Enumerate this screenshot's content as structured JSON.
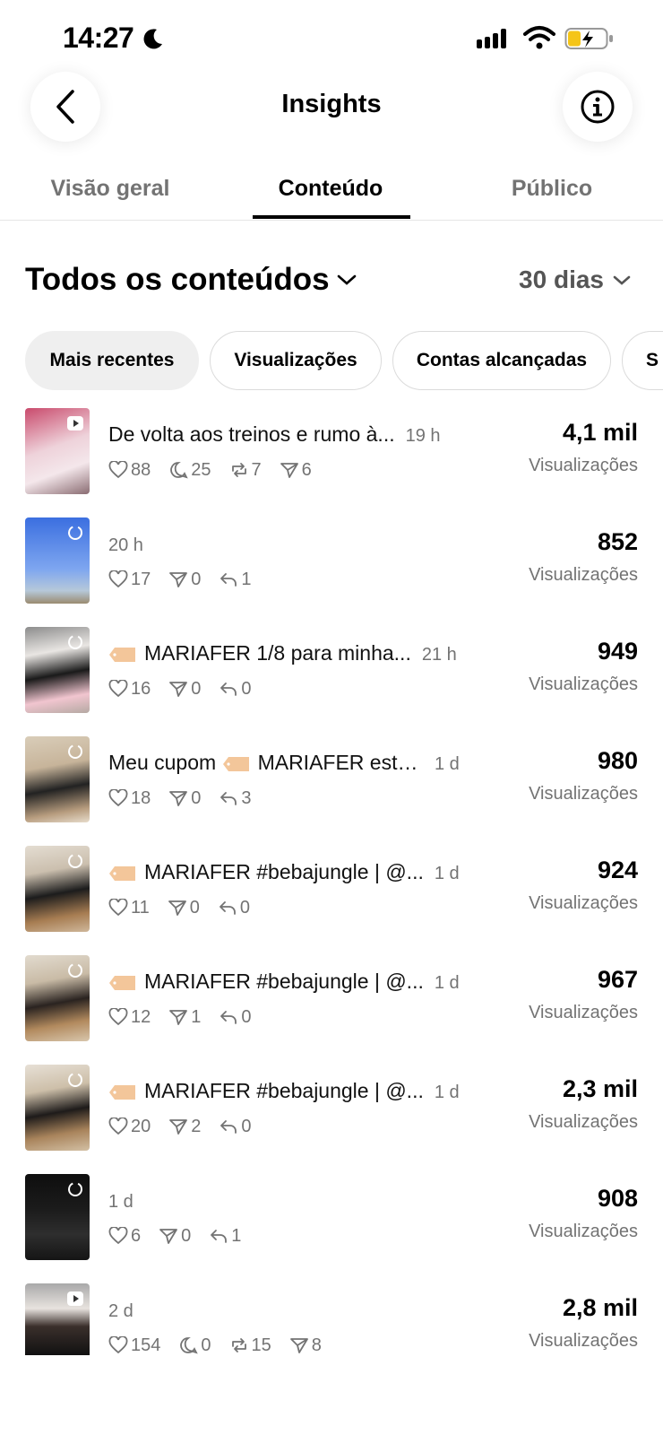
{
  "status_bar": {
    "time": "14:27"
  },
  "header": {
    "title": "Insights"
  },
  "tabs": [
    {
      "label": "Visão geral"
    },
    {
      "label": "Conteúdo"
    },
    {
      "label": "Público"
    }
  ],
  "filter": {
    "title": "Todos os conteúdos",
    "period": "30 dias"
  },
  "chips": [
    {
      "label": "Mais recentes"
    },
    {
      "label": "Visualizações"
    },
    {
      "label": "Contas alcançadas"
    },
    {
      "label": "S"
    }
  ],
  "posts": [
    {
      "caption": "De volta aos treinos e rumo à...",
      "age": "19 h",
      "likes": "88",
      "comments": "25",
      "reposts": "7",
      "shares": "6",
      "views": "4,1 mil",
      "views_label": "Visualizações"
    },
    {
      "caption": "",
      "age": "20 h",
      "likes": "17",
      "shares": "0",
      "replies": "1",
      "views": "852",
      "views_label": "Visualizações"
    },
    {
      "caption": "MARIAFER 1/8 para minha...",
      "age": "21 h",
      "likes": "16",
      "shares": "0",
      "replies": "0",
      "views": "949",
      "views_label": "Visualizações"
    },
    {
      "caption_prefix": "Meu cupom",
      "caption": "MARIAFER está...",
      "age": "1 d",
      "likes": "18",
      "shares": "0",
      "replies": "3",
      "views": "980",
      "views_label": "Visualizações"
    },
    {
      "caption": "MARIAFER #bebajungle | @...",
      "age": "1 d",
      "likes": "11",
      "shares": "0",
      "replies": "0",
      "views": "924",
      "views_label": "Visualizações"
    },
    {
      "caption": "MARIAFER #bebajungle | @...",
      "age": "1 d",
      "likes": "12",
      "shares": "1",
      "replies": "0",
      "views": "967",
      "views_label": "Visualizações"
    },
    {
      "caption": "MARIAFER #bebajungle | @...",
      "age": "1 d",
      "likes": "20",
      "shares": "2",
      "replies": "0",
      "views": "2,3 mil",
      "views_label": "Visualizações"
    },
    {
      "caption": "",
      "age": "1 d",
      "likes": "6",
      "shares": "0",
      "replies": "1",
      "views": "908",
      "views_label": "Visualizações"
    },
    {
      "caption": "",
      "age": "2 d",
      "likes": "154",
      "comments": "0",
      "reposts": "15",
      "shares": "8",
      "views": "2,8 mil",
      "views_label": "Visualizações"
    }
  ]
}
